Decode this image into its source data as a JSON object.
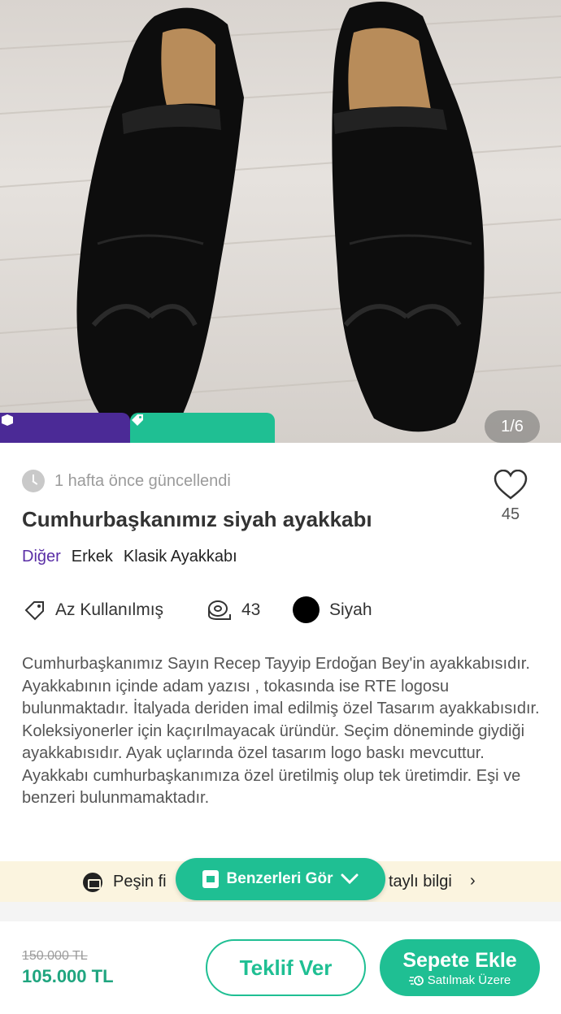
{
  "gallery": {
    "counter": "1/6"
  },
  "listing": {
    "updated_text": "1 hafta önce güncellendi",
    "title": "Cumhurbaşkanımız siyah ayakkabı",
    "favorites_count": "45",
    "breadcrumbs": [
      "Diğer",
      "Erkek",
      "Klasik Ayakkabı"
    ],
    "attributes": {
      "condition": "Az Kullanılmış",
      "size": "43",
      "color": "Siyah"
    },
    "description": "Cumhurbaşkanımız Sayın Recep Tayyip Erdoğan Bey'in ayakkabısıdır. Ayakkabının içinde adam yazısı , tokasında ise RTE logosu bulunmaktadır. İtalyada deriden imal edilmiş özel Tasarım ayakkabısıdır. Koleksiyonerler için kaçırılmayacak üründür. Seçim döneminde giydiği ayakkabısıdır. Ayak uçlarında özel tasarım logo baskı mevcuttur. Ayakkabı cumhurbaşkanımıza özel üretilmiş olup tek üretimdir. Eşi ve benzeri bulunmamaktadır."
  },
  "banner": {
    "left_text": "Peşin fi",
    "right_text": "taylı bilgi",
    "chevron": "›"
  },
  "similar_button": {
    "label": "Benzerleri Gör"
  },
  "pricing": {
    "old_price": "150.000 TL",
    "new_price": "105.000 TL"
  },
  "actions": {
    "offer_label": "Teklif Ver",
    "cart_label": "Sepete Ekle",
    "cart_sub": "Satılmak Üzere"
  },
  "colors": {
    "accent": "#1fbf93",
    "purple": "#4b2a96",
    "banner_bg": "#fbf4df"
  },
  "icons": [
    "clock-icon",
    "heart-icon",
    "tag-icon",
    "tape-measure-icon",
    "card-icon",
    "chevron-right-icon",
    "chevron-down-icon",
    "bolt-icon",
    "box-icon"
  ]
}
